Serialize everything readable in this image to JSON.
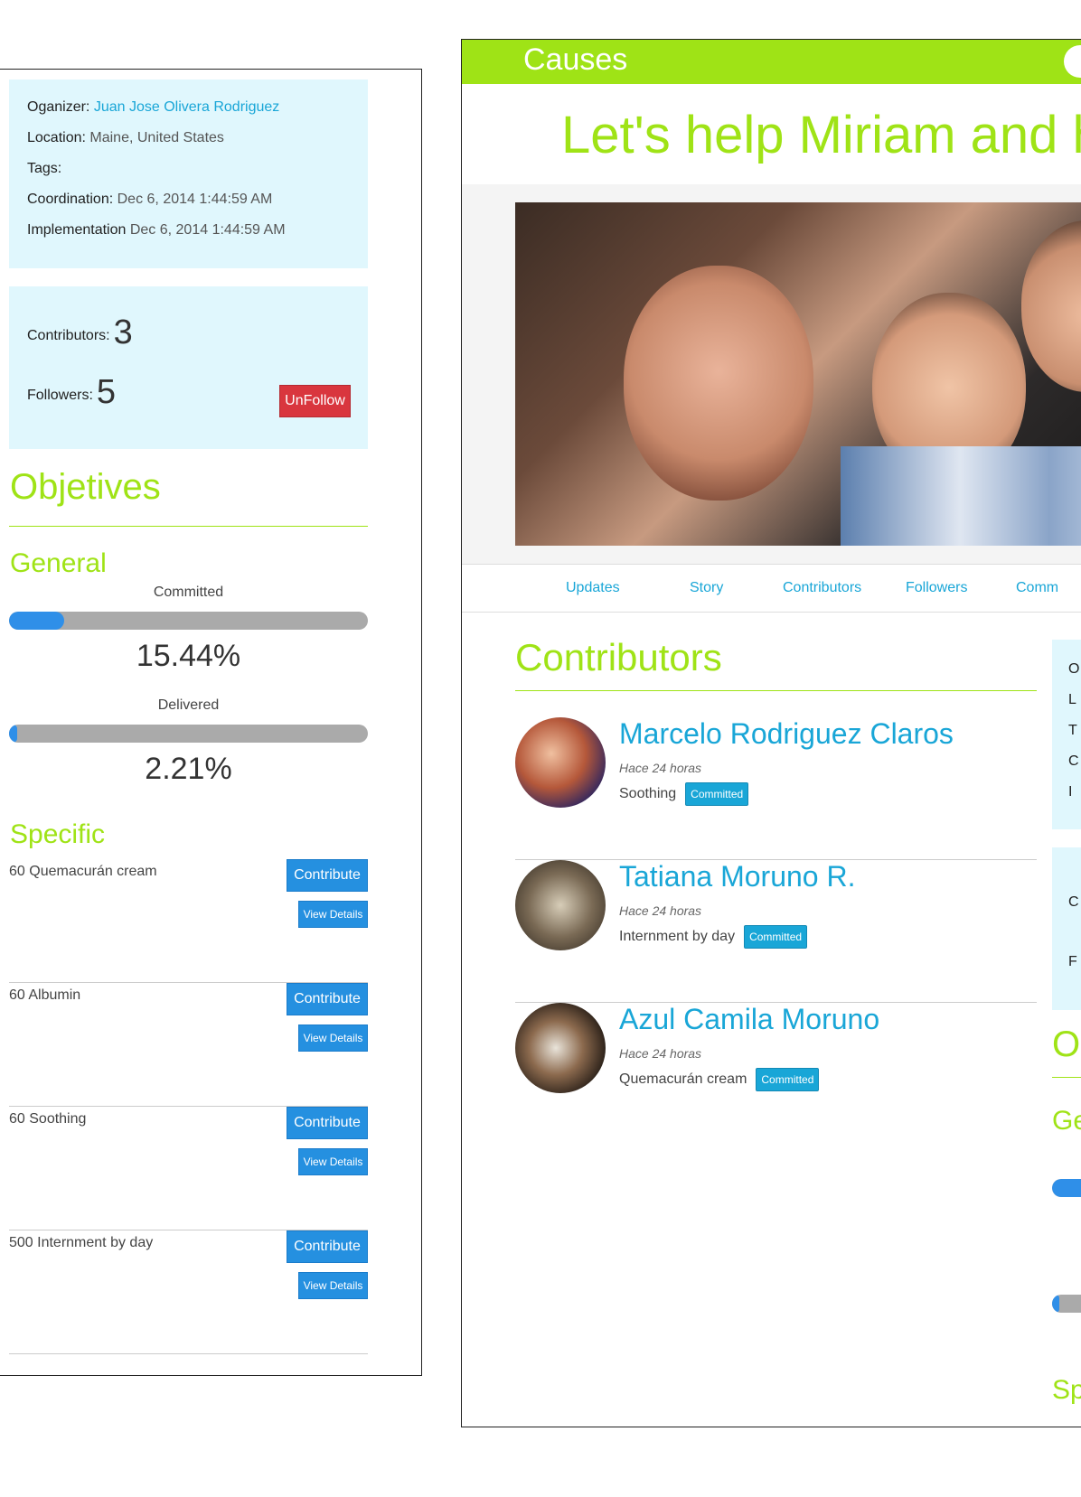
{
  "left": {
    "info": {
      "organizer_label": "Oganizer:",
      "organizer_value": "Juan Jose Olivera Rodriguez",
      "location_label": "Location:",
      "location_value": "Maine, United States",
      "tags_label": "Tags:",
      "coordination_label": "Coordination:",
      "coordination_value": "Dec 6, 2014 1:44:59 AM",
      "implementation_label": "Implementation",
      "implementation_value": "Dec 6, 2014 1:44:59 AM"
    },
    "stats": {
      "contributors_label": "Contributors:",
      "contributors_value": "3",
      "followers_label": "Followers:",
      "followers_value": "5",
      "unfollow_label": "UnFollow"
    },
    "objectives_heading": "Objetives",
    "general_heading": "General",
    "committed": {
      "label": "Committed",
      "value_text": "15.44%",
      "fraction": 0.1544
    },
    "delivered": {
      "label": "Delivered",
      "value_text": "2.21%",
      "fraction": 0.0221
    },
    "specific_heading": "Specific",
    "specific_items": [
      {
        "name": "60 Quemacurán cream"
      },
      {
        "name": "60 Albumin"
      },
      {
        "name": "60 Soothing"
      },
      {
        "name": "500 Internment by day"
      }
    ],
    "contribute_label": "Contribute",
    "view_details_label": "View Details"
  },
  "right": {
    "brand": "Causes",
    "cause_title": "Let's help Miriam and h",
    "tabs": [
      "Updates",
      "Story",
      "Contributors",
      "Followers",
      "Comm"
    ],
    "contributors_heading": "Contributors",
    "contributors": [
      {
        "name": "Marcelo Rodriguez Claros",
        "time": "Hace 24 horas",
        "item": "Soothing",
        "status": "Committed"
      },
      {
        "name": "Tatiana Moruno R.",
        "time": "Hace 24 horas",
        "item": "Internment by day",
        "status": "Committed"
      },
      {
        "name": "Azul Camila Moruno",
        "time": "Hace 24 horas",
        "item": "Quemacurán cream",
        "status": "Committed"
      }
    ],
    "side_letters": [
      "O",
      "L",
      "T",
      "C",
      "I"
    ],
    "side_stat_letters": [
      "C",
      "F"
    ],
    "side_headings": [
      "O",
      "Ge",
      "Sp"
    ]
  }
}
